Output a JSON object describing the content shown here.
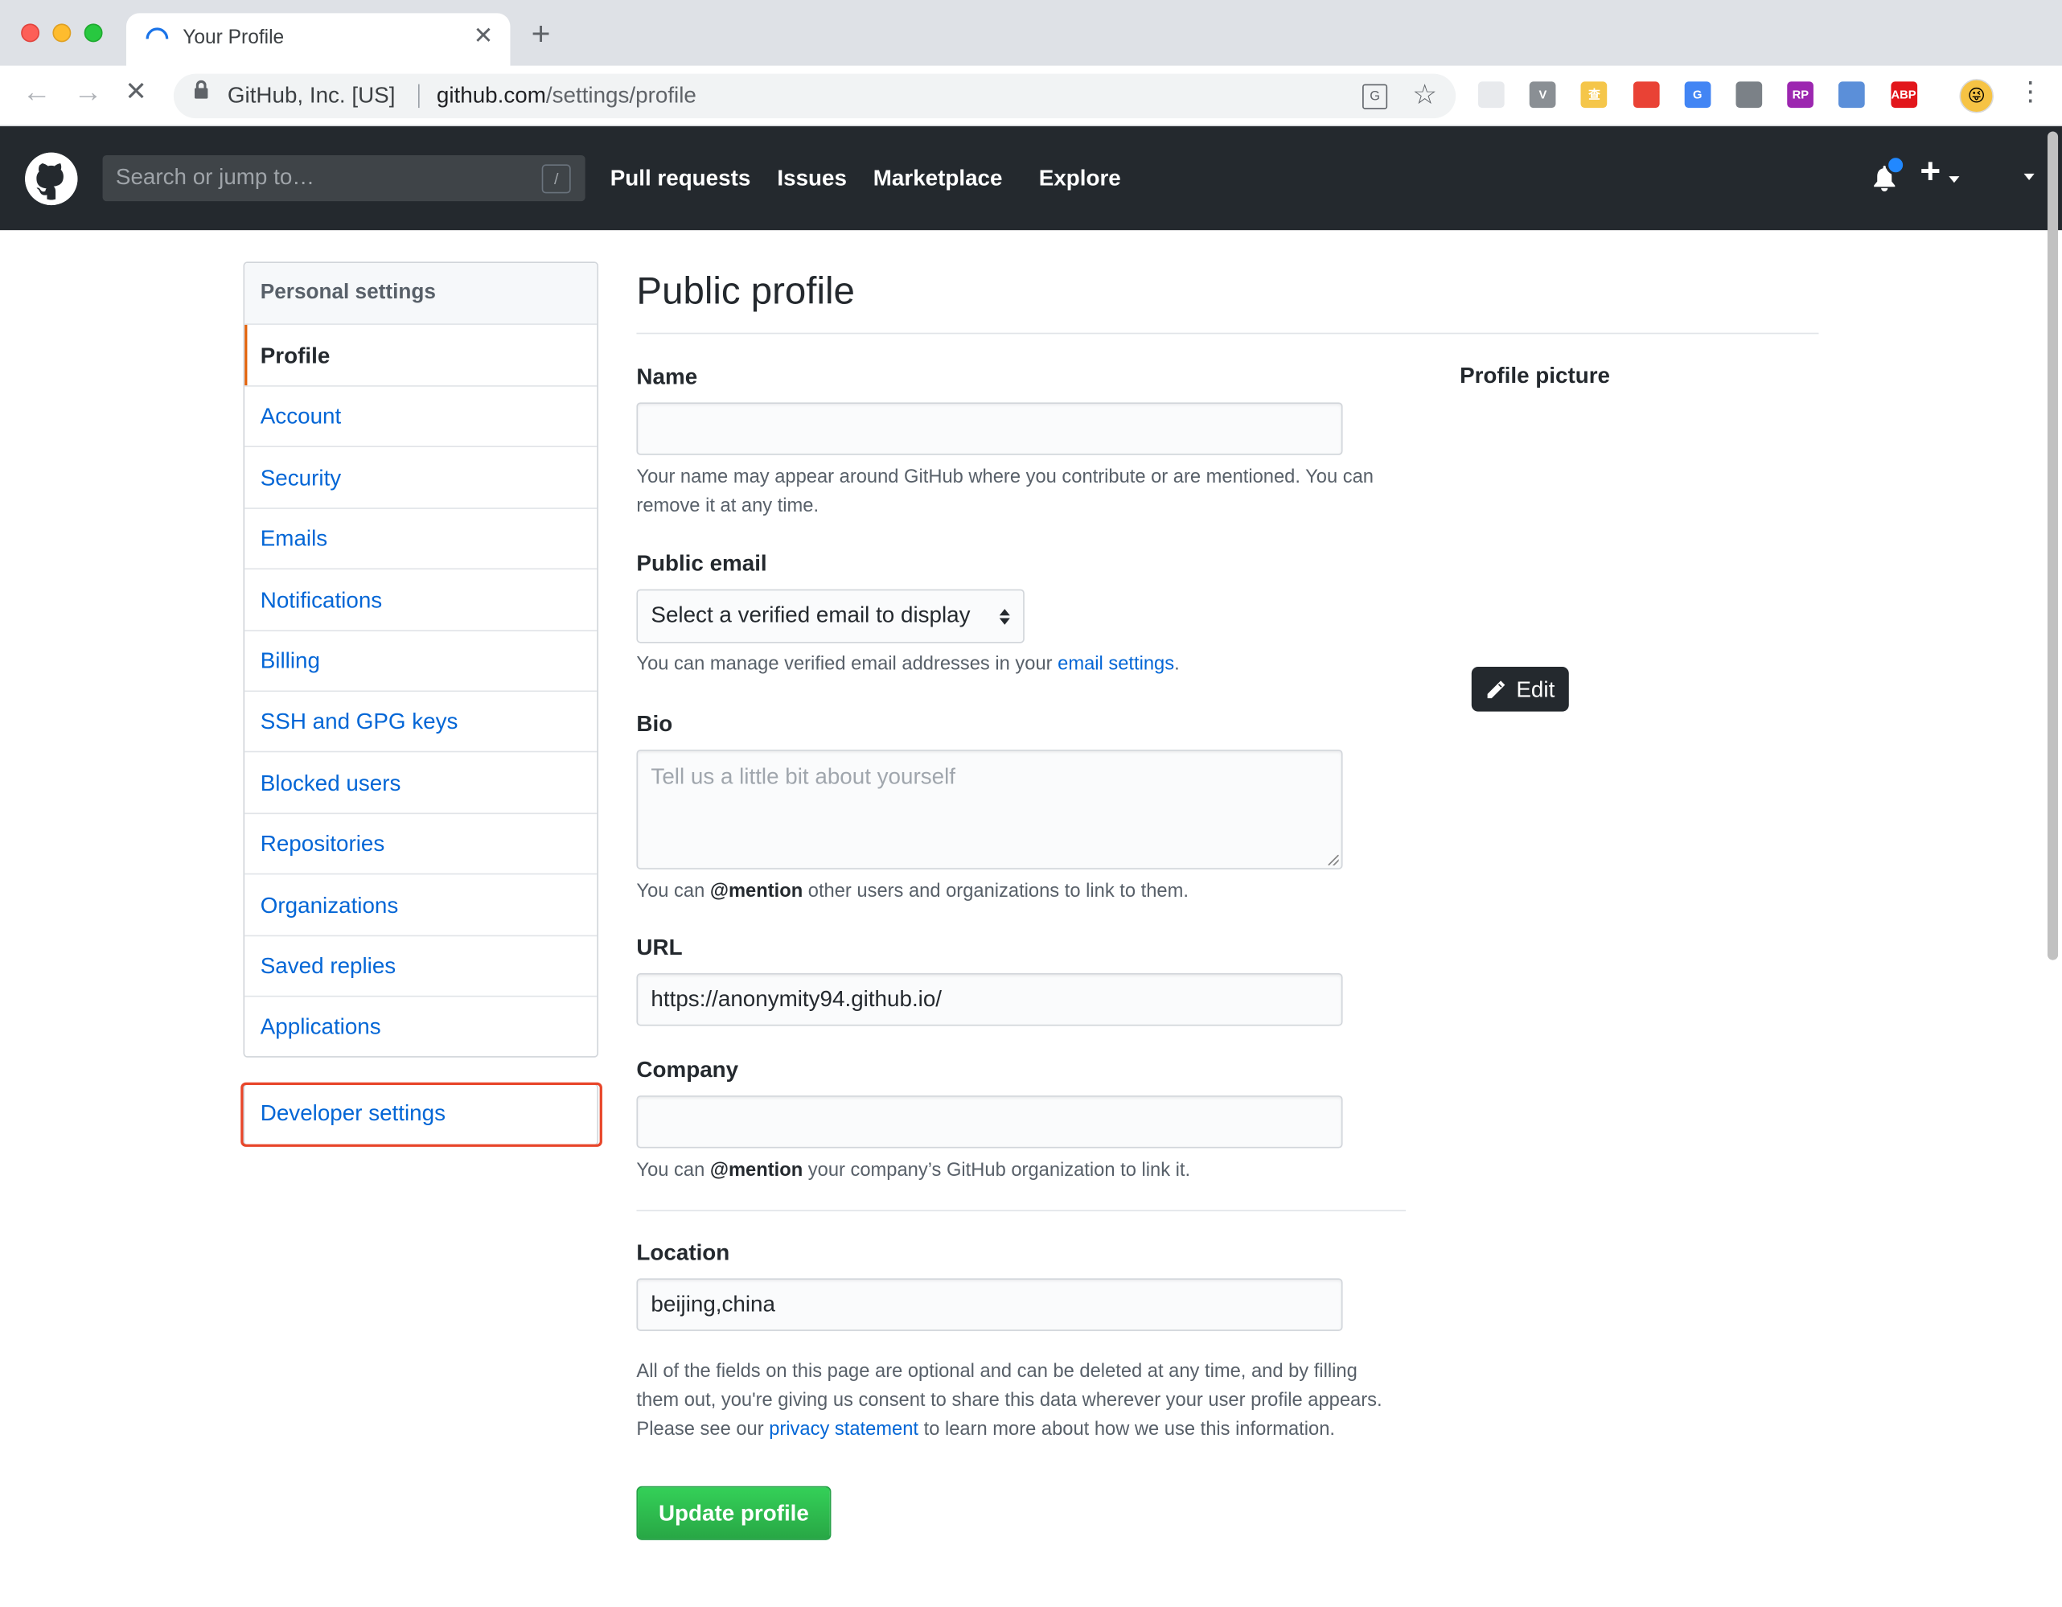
{
  "browser": {
    "tab_title": "Your Profile",
    "site_identity": "GitHub, Inc. [US]",
    "url_host": "github.com",
    "url_path": "/settings/profile",
    "extensions": [
      {
        "name": "ext-grid-icon",
        "glyph": "",
        "color": "#e8eaed"
      },
      {
        "name": "ext-vue-icon",
        "glyph": "V",
        "color": "#8a8f94"
      },
      {
        "name": "ext-dictionary-icon",
        "glyph": "查",
        "color": "#f5c64a"
      },
      {
        "name": "ext-colorful-icon",
        "glyph": "",
        "color": "#e94235"
      },
      {
        "name": "ext-google-translate-icon",
        "glyph": "G",
        "color": "#4285f4"
      },
      {
        "name": "ext-parachute-icon",
        "glyph": "",
        "color": "#7b8187"
      },
      {
        "name": "ext-rp-icon",
        "glyph": "RP",
        "color": "#9c27b0"
      },
      {
        "name": "ext-circle-icon",
        "glyph": "",
        "color": "#5b8fd9"
      },
      {
        "name": "ext-adblock-plus-icon",
        "glyph": "ABP",
        "color": "#e2161b"
      }
    ]
  },
  "header": {
    "search_placeholder": "Search or jump to…",
    "search_shortcut": "/",
    "nav": [
      "Pull requests",
      "Issues",
      "Marketplace",
      "Explore"
    ]
  },
  "sidebar": {
    "heading": "Personal settings",
    "items": [
      {
        "label": "Profile",
        "selected": true
      },
      {
        "label": "Account",
        "selected": false
      },
      {
        "label": "Security",
        "selected": false
      },
      {
        "label": "Emails",
        "selected": false
      },
      {
        "label": "Notifications",
        "selected": false
      },
      {
        "label": "Billing",
        "selected": false
      },
      {
        "label": "SSH and GPG keys",
        "selected": false
      },
      {
        "label": "Blocked users",
        "selected": false
      },
      {
        "label": "Repositories",
        "selected": false
      },
      {
        "label": "Organizations",
        "selected": false
      },
      {
        "label": "Saved replies",
        "selected": false
      },
      {
        "label": "Applications",
        "selected": false
      }
    ],
    "developer_settings": "Developer settings"
  },
  "main": {
    "title": "Public profile",
    "name": {
      "label": "Name",
      "value": "",
      "note": "Your name may appear around GitHub where you contribute or are mentioned. You can remove it at any time."
    },
    "public_email": {
      "label": "Public email",
      "selected": "Select a verified email to display",
      "note_prefix": "You can manage verified email addresses in your ",
      "note_link": "email settings",
      "note_suffix": "."
    },
    "bio": {
      "label": "Bio",
      "placeholder": "Tell us a little bit about yourself",
      "note_prefix": "You can ",
      "note_mention": "@mention",
      "note_suffix": " other users and organizations to link to them."
    },
    "url": {
      "label": "URL",
      "value": "https://anonymity94.github.io/"
    },
    "company": {
      "label": "Company",
      "value": "",
      "note_prefix": "You can ",
      "note_mention": "@mention",
      "note_suffix": " your company’s GitHub organization to link it."
    },
    "location": {
      "label": "Location",
      "value": "beijing,china"
    },
    "disclaimer_prefix": "All of the fields on this page are optional and can be deleted at any time, and by filling them out, you're giving us consent to share this data wherever your user profile appears. Please see our ",
    "disclaimer_link": "privacy statement",
    "disclaimer_suffix": " to learn more about how we use this information.",
    "submit": "Update profile"
  },
  "profile_picture": {
    "label": "Profile picture",
    "edit": "Edit"
  },
  "colors": {
    "header_bg": "#24292e",
    "link": "#0366d6",
    "accent_selected": "#e36209",
    "primary_button": "#28a745",
    "highlight_outline": "#e8462a"
  }
}
